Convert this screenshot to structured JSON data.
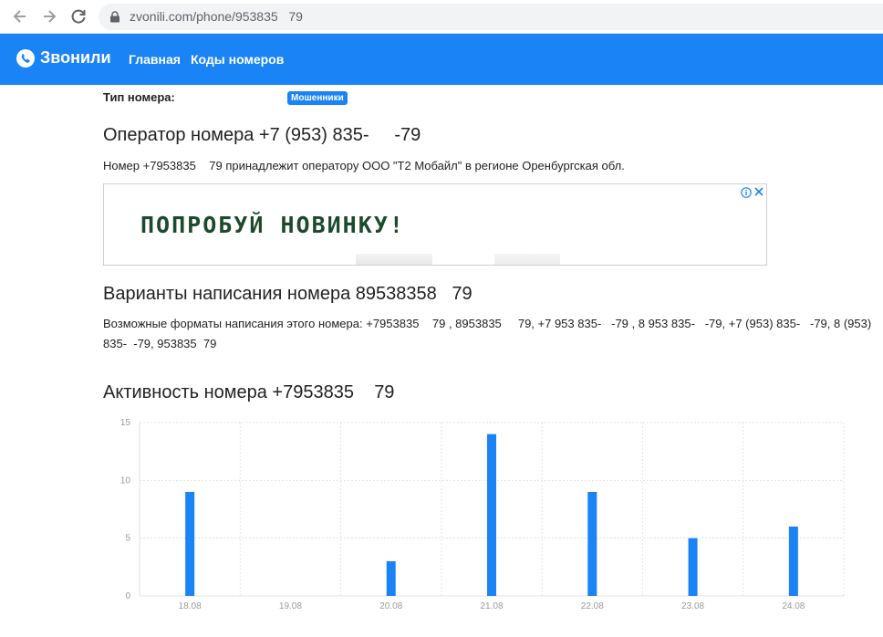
{
  "browser": {
    "url": "zvonili.com/phone/953835   79"
  },
  "header": {
    "logo": "Звонили",
    "nav": [
      "Главная",
      "Коды номеров"
    ],
    "brand_color": "#1a83f6"
  },
  "number_type": {
    "label": "Тип номера:",
    "badge": "Мошенники"
  },
  "operator": {
    "title": "Оператор номера +7 (953) 835-     -79",
    "text": "Номер +7953835    79 принадлежит оператору ООО \"Т2 Мобайл\" в регионе Оренбургская обл."
  },
  "ad": {
    "text": "ПОПРОБУЙ НОВИНКУ!"
  },
  "variants": {
    "title": "Варианты написания номера 89538358   79",
    "text": "Возможные форматы написания этого номера: +7953835    79 , 8953835     79, +7 953 835-   -79 , 8 953 835-   -79, +7 (953) 835-   -79, 8 (953) 835-  -79, 953835  79"
  },
  "activity": {
    "title": "Активность номера +7953835    79"
  },
  "chart_data": {
    "type": "bar",
    "categories": [
      "18.08",
      "19.08",
      "20.08",
      "21.08",
      "22.08",
      "23.08",
      "24.08"
    ],
    "values": [
      9,
      0,
      3,
      14,
      9,
      5,
      6
    ],
    "yticks": [
      0,
      5,
      10,
      15
    ],
    "ylim": [
      0,
      15
    ],
    "grid": true,
    "bar_color": "#1a83f6"
  }
}
